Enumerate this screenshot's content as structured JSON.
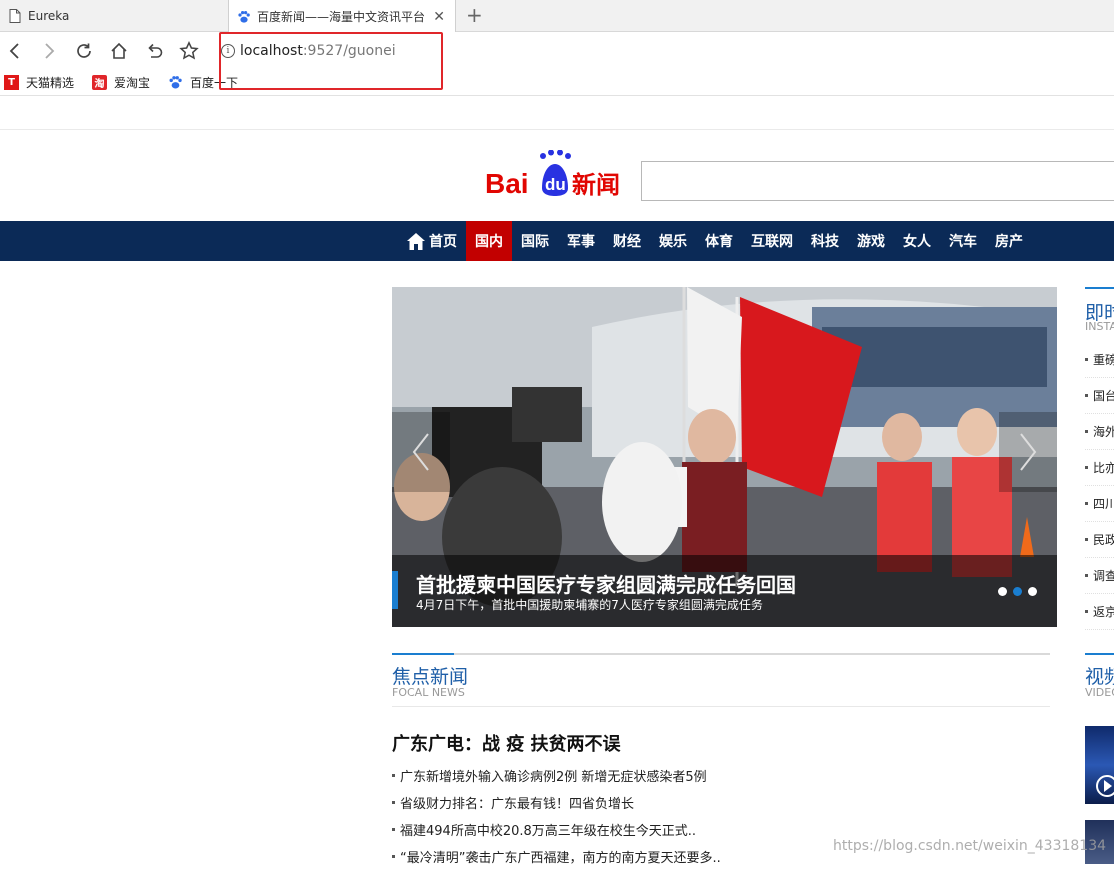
{
  "browser": {
    "tabs": [
      {
        "title": "Eureka"
      },
      {
        "title": "百度新闻——海量中文资讯平台"
      }
    ],
    "url_host": "localhost",
    "url_rest": ":9527/guonei",
    "bookmarks": [
      {
        "label": "天猫精选",
        "icon": "tmall-icon",
        "icon_text": "T"
      },
      {
        "label": "爱淘宝",
        "icon": "taobao-icon",
        "icon_text": "淘"
      },
      {
        "label": "百度一下",
        "icon": "baidu-paw-icon",
        "icon_text": ""
      }
    ]
  },
  "header": {
    "logo_text_a": "Bai",
    "logo_text_b": "du",
    "logo_text_c": "新闻",
    "search_value": ""
  },
  "nav": {
    "items": [
      {
        "label": "首页",
        "icon": "home-icon"
      },
      {
        "label": "国内"
      },
      {
        "label": "国际"
      },
      {
        "label": "军事"
      },
      {
        "label": "财经"
      },
      {
        "label": "娱乐"
      },
      {
        "label": "体育"
      },
      {
        "label": "互联网"
      },
      {
        "label": "科技"
      },
      {
        "label": "游戏"
      },
      {
        "label": "女人"
      },
      {
        "label": "汽车"
      },
      {
        "label": "房产"
      }
    ],
    "active": "国内"
  },
  "slider": {
    "title": "首批援柬中国医疗专家组圆满完成任务回国",
    "subtitle": "4月7日下午，首批中国援助柬埔寨的7人医疗专家组圆满完成任务",
    "current_slide": 2,
    "slide_count": 3
  },
  "focal": {
    "title": "焦点新闻",
    "subtitle": "FOCAL NEWS",
    "headline": "广东广电：战 疫 扶贫两不误",
    "items": [
      "广东新增境外输入确诊病例2例 新增无症状感染者5例",
      "省级财力排名：广东最有钱！四省负增长",
      "福建494所高中校20.8万高三年级在校生今天正式..",
      "“最冷清明”袭击广东广西福建，南方的南方夏天还要多.."
    ]
  },
  "right_column": {
    "title": "即时新闻",
    "subtitle": "INSTANT NEWS",
    "items": [
      "重磅",
      "国台",
      "海外",
      "比亦",
      "四川",
      "民政",
      "调查",
      "返京"
    ],
    "video_title": "视频",
    "video_subtitle": "VIDEO"
  },
  "watermark": "https://blog.csdn.net/weixin_43318134",
  "colors": {
    "nav_bg": "#0b2a57",
    "nav_active": "#c20000",
    "accent_blue": "#1a7ed0",
    "annotation_red": "#e0262a",
    "baidu_red": "#e10602",
    "baidu_blue": "#2932e1"
  }
}
